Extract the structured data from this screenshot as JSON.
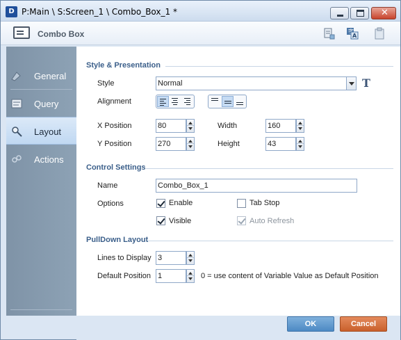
{
  "window": {
    "title": "P:Main \\ S:Screen_1 \\ Combo_Box_1 *",
    "app_icon_text": "D"
  },
  "header": {
    "title": "Combo Box"
  },
  "sidebar": {
    "items": [
      {
        "label": "General",
        "icon": "general-icon",
        "active": false
      },
      {
        "label": "Query",
        "icon": "query-icon",
        "active": false
      },
      {
        "label": "Layout",
        "icon": "layout-icon",
        "active": true
      },
      {
        "label": "Actions",
        "icon": "actions-icon",
        "active": false
      }
    ]
  },
  "style_section": {
    "title": "Style & Presentation",
    "style_label": "Style",
    "style_value": "Normal",
    "alignment_label": "Alignment",
    "x_label": "X Position",
    "x_value": "80",
    "y_label": "Y Position",
    "y_value": "270",
    "width_label": "Width",
    "width_value": "160",
    "height_label": "Height",
    "height_value": "43"
  },
  "control_section": {
    "title": "Control Settings",
    "name_label": "Name",
    "name_value": "Combo_Box_1",
    "options_label": "Options",
    "enable_label": "Enable",
    "tabstop_label": "Tab Stop",
    "visible_label": "Visible",
    "autorefresh_label": "Auto Refresh"
  },
  "pulldown_section": {
    "title": "PullDown Layout",
    "lines_label": "Lines to Display",
    "lines_value": "3",
    "default_label": "Default Position",
    "default_value": "1",
    "default_hint": "0 = use content of Variable Value as Default Position"
  },
  "footer": {
    "ok_label": "OK",
    "cancel_label": "Cancel"
  }
}
